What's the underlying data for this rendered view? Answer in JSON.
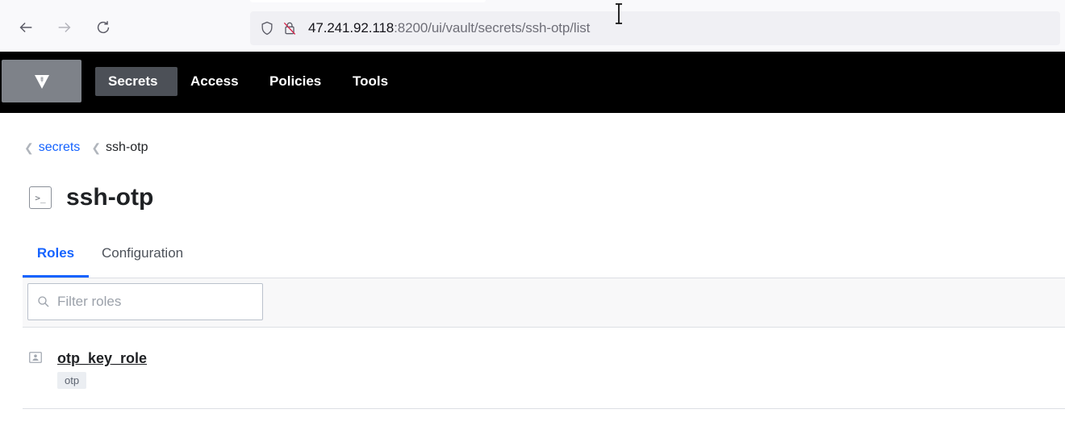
{
  "browser": {
    "url_host": "47.241.92.118",
    "url_rest": ":8200/ui/vault/secrets/ssh-otp/list"
  },
  "nav": {
    "items": [
      {
        "label": "Secrets",
        "active": true
      },
      {
        "label": "Access",
        "active": false
      },
      {
        "label": "Policies",
        "active": false
      },
      {
        "label": "Tools",
        "active": false
      }
    ]
  },
  "breadcrumb": {
    "parent": "secrets",
    "current": "ssh-otp"
  },
  "page": {
    "title": "ssh-otp",
    "title_icon_glyph": ">_"
  },
  "tabs": [
    {
      "label": "Roles",
      "active": true
    },
    {
      "label": "Configuration",
      "active": false
    }
  ],
  "filter": {
    "placeholder": "Filter roles",
    "value": ""
  },
  "roles": [
    {
      "name": "otp_key_role",
      "badge": "otp"
    }
  ],
  "colors": {
    "accent": "#1563ff",
    "header_bg": "#000000",
    "nav_active_bg": "#4c5057",
    "logo_bg": "#7e8289"
  }
}
